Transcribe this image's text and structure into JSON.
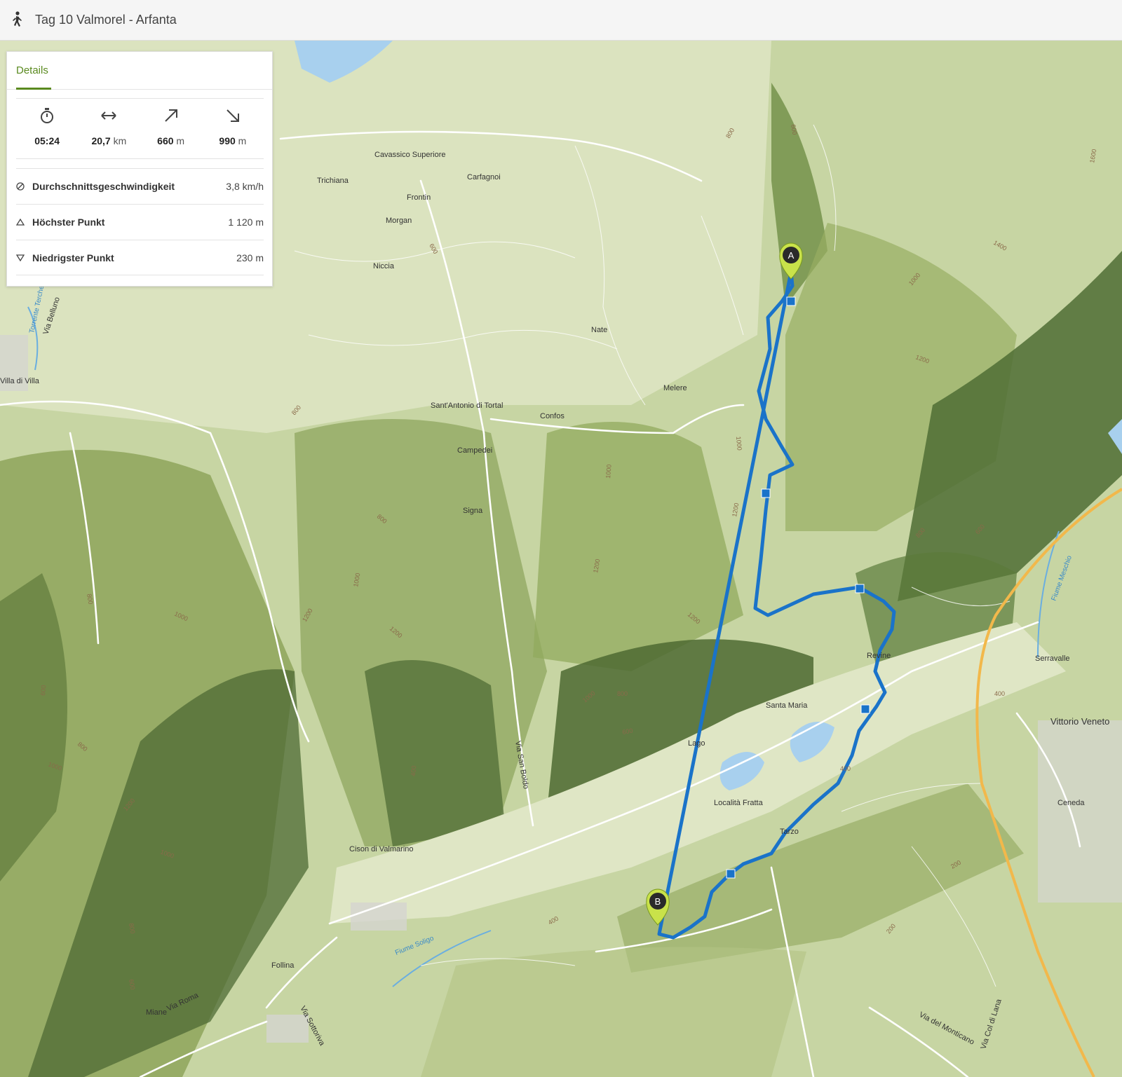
{
  "header": {
    "title": "Tag 10 Valmorel - Arfanta",
    "icon": "hiker-icon"
  },
  "panel": {
    "tab": "Details",
    "stats": [
      {
        "icon": "stopwatch-icon",
        "value": "05:24",
        "unit": ""
      },
      {
        "icon": "distance-icon",
        "value": "20,7",
        "unit": "km"
      },
      {
        "icon": "ascent-icon",
        "value": "660",
        "unit": "m"
      },
      {
        "icon": "descent-icon",
        "value": "990",
        "unit": "m"
      }
    ],
    "rows": [
      {
        "icon": "speed-icon",
        "label": "Durchschnittsgeschwindigkeit",
        "value": "3,8 km/h"
      },
      {
        "icon": "triangle-up-icon",
        "label": "Höchster Punkt",
        "value": "1 120 m"
      },
      {
        "icon": "triangle-down-icon",
        "label": "Niedrigster Punkt",
        "value": "230 m"
      }
    ]
  },
  "map": {
    "markers": {
      "start": "A",
      "end": "B"
    },
    "places": [
      "Cavassico Superiore",
      "Trichiana",
      "Frontin",
      "Carfagnoi",
      "Morgan",
      "Niccia",
      "Nate",
      "Melere",
      "Villa di Villa",
      "Sant'Antonio di Tortal",
      "Confos",
      "Campedei",
      "Signa",
      "Revine",
      "Santa Maria",
      "Lago",
      "Località Fratta",
      "Tarzo",
      "Cison di Valmarino",
      "Serravalle",
      "Vittorio Veneto",
      "Ceneda",
      "Follina",
      "Miane"
    ],
    "roads": [
      "Via Belluno",
      "Via San Boldo",
      "Via Roma",
      "Via Sottoriva",
      "Via del Monticano",
      "Via Col di Lana"
    ],
    "waters": [
      "Torrente Terche",
      "Fiume Soligo",
      "Fiume Meschio"
    ],
    "contours": [
      "600",
      "800",
      "1000",
      "1200",
      "1400",
      "1600",
      "400",
      "200"
    ],
    "route_color": "#1a73c9"
  }
}
